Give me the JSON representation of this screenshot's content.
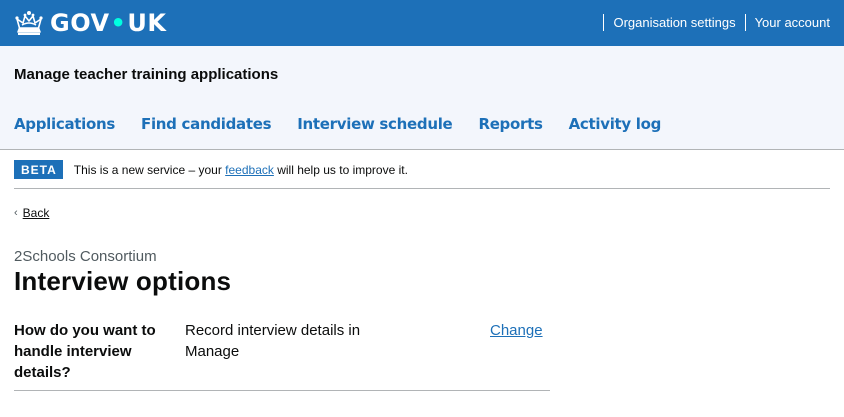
{
  "header": {
    "logo_prefix": "GOV",
    "logo_dot": "•",
    "logo_suffix": "UK",
    "logo_icon": "crown-icon",
    "account_links": [
      {
        "label": "Organisation settings"
      },
      {
        "label": "Your account"
      }
    ]
  },
  "service": {
    "name": "Manage teacher training applications"
  },
  "nav": {
    "items": [
      {
        "label": "Applications"
      },
      {
        "label": "Find candidates"
      },
      {
        "label": "Interview schedule"
      },
      {
        "label": "Reports"
      },
      {
        "label": "Activity log"
      }
    ]
  },
  "beta_banner": {
    "tag": "BETA",
    "text_before": "This is a new service – your ",
    "link": "feedback",
    "text_after": " will help us to improve it."
  },
  "back_link": {
    "label": "Back",
    "chevron": "‹"
  },
  "page": {
    "caption": "2Schools Consortium",
    "title": "Interview options"
  },
  "summary": {
    "rows": [
      {
        "key": "How do you want to handle interview details?",
        "value": "Record interview details in Manage",
        "action": "Change"
      }
    ]
  },
  "colors": {
    "brand_blue": "#1d70b8",
    "service_bg": "#f3f6fc",
    "text": "#0b0c0c",
    "secondary_text": "#505a5f",
    "border": "#b1b4b6"
  }
}
